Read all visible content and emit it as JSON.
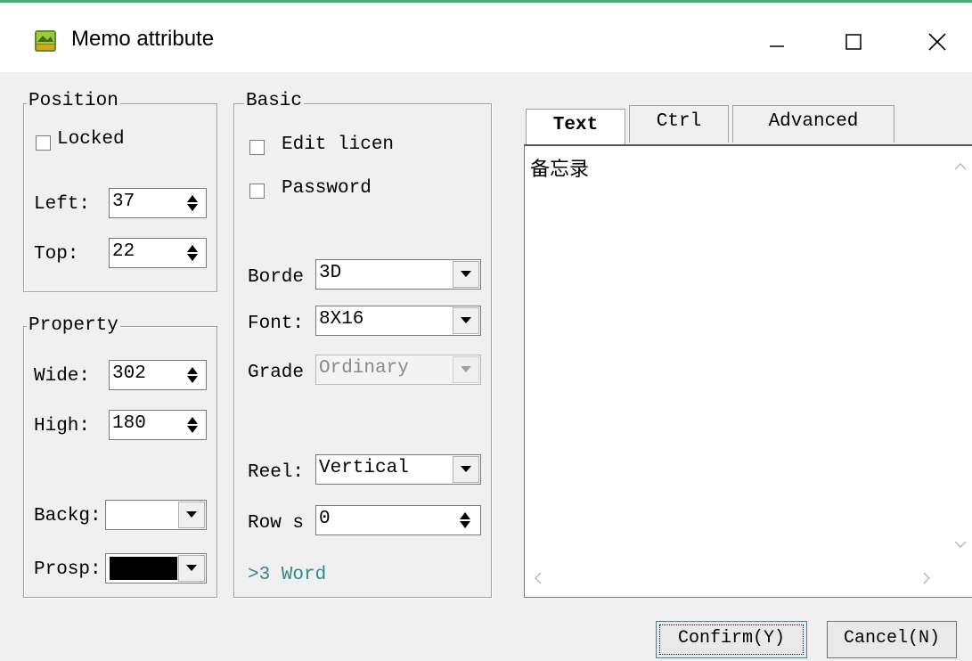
{
  "window": {
    "title": "Memo attribute",
    "controls": [
      "minimize",
      "maximize",
      "close"
    ]
  },
  "position": {
    "legend": "Position",
    "locked_label": "Locked",
    "locked_checked": false,
    "left_label": "Left:",
    "left_value": "37",
    "top_label": "Top:",
    "top_value": "22"
  },
  "property": {
    "legend": "Property",
    "wide_label": "Wide:",
    "wide_value": "302",
    "high_label": "High:",
    "high_value": "180",
    "backg_label": "Backg:",
    "backg_color": "#ffffff",
    "prosp_label": "Prosp:",
    "prosp_color": "#000000"
  },
  "basic": {
    "legend": "Basic",
    "edit_label": "Edit licen",
    "edit_checked": false,
    "password_label": "Password",
    "password_checked": false,
    "border_label": "Borde",
    "border_value": "3D",
    "font_label": "Font:",
    "font_value": "8X16",
    "grade_label": "Grade",
    "grade_value": "Ordinary",
    "reel_label": "Reel:",
    "reel_value": "Vertical",
    "rows_label": "Row s",
    "rows_value": "0",
    "hint": ">3 Word",
    "hint_color": "#2e8b8b"
  },
  "tabs": [
    {
      "label": "Text",
      "active": true
    },
    {
      "label": "Ctrl",
      "active": false
    },
    {
      "label": "Advanced",
      "active": false
    }
  ],
  "text_area": {
    "content": "备忘录"
  },
  "buttons": {
    "confirm": "Confirm(Y)",
    "cancel": "Cancel(N)"
  }
}
